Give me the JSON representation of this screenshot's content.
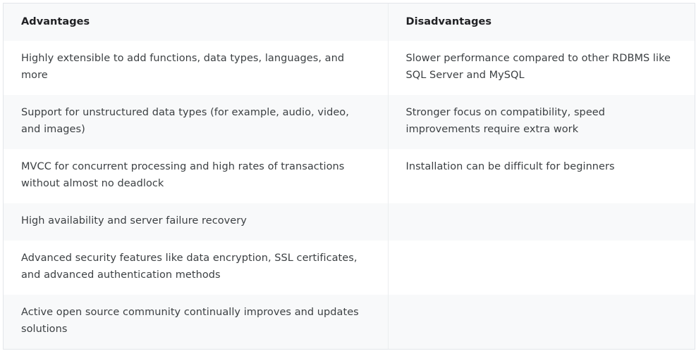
{
  "table": {
    "headers": [
      "Advantages",
      "Disadvantages"
    ],
    "rows": [
      [
        "Highly extensible to add functions, data types, languages, and more",
        "Slower performance compared to other RDBMS like SQL Server and MySQL"
      ],
      [
        "Support for unstructured data types (for example, audio, video, and images)",
        "Stronger focus on compatibility, speed improvements require extra work"
      ],
      [
        "MVCC for concurrent processing and high rates of transactions without almost no deadlock",
        "Installation can be difficult for beginners"
      ],
      [
        "High availability and server failure recovery",
        ""
      ],
      [
        "Advanced security features like data encryption, SSL certificates, and advanced authentication methods",
        ""
      ],
      [
        "Active open source community continually improves and updates solutions",
        ""
      ]
    ]
  }
}
